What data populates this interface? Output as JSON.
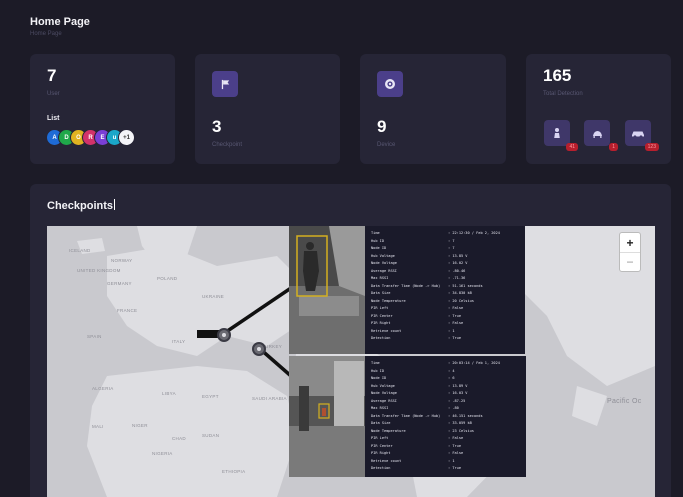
{
  "header": {
    "title": "Home Page",
    "breadcrumb": "Home Page"
  },
  "stats": {
    "users": {
      "value": "7",
      "label": "User",
      "list_label": "List",
      "avatars": [
        {
          "letter": "A",
          "color": "#1e6bd6"
        },
        {
          "letter": "D",
          "color": "#1fa84a"
        },
        {
          "letter": "O",
          "color": "#e0b321"
        },
        {
          "letter": "R",
          "color": "#d2326a"
        },
        {
          "letter": "E",
          "color": "#7a3fd6"
        },
        {
          "letter": "u",
          "color": "#1aa7c9"
        },
        {
          "letter": "+1",
          "color": "#f4f4f8"
        }
      ]
    },
    "checkpoint": {
      "value": "3",
      "label": "Checkpoint",
      "icon": "flag-icon"
    },
    "device": {
      "value": "9",
      "label": "Device",
      "icon": "camera-icon"
    },
    "detection": {
      "value": "165",
      "label": "Total Detection",
      "items": [
        {
          "icon": "person-icon",
          "count": "41"
        },
        {
          "icon": "animal-icon",
          "count": "1"
        },
        {
          "icon": "vehicle-icon",
          "count": "123"
        }
      ]
    }
  },
  "checkpoints": {
    "title": "Checkpoints",
    "map_labels": [
      "ICELAND",
      "NORWAY",
      "UNITED KINGDOM",
      "GERMANY",
      "POLAND",
      "UKRAINE",
      "FRANCE",
      "SPAIN",
      "ITALY",
      "TURKEY",
      "ALGERIA",
      "LIBYA",
      "EGYPT",
      "SAUDI ARABIA",
      "MALI",
      "NIGER",
      "CHAD",
      "SUDAN",
      "NIGERIA",
      "ETHIOPIA",
      "Pacific Oc"
    ],
    "popup1": [
      {
        "k": "Time",
        "v": ": 22:12:30 / Feb 2, 2024"
      },
      {
        "k": "Hub ID",
        "v": ": 7"
      },
      {
        "k": "Node ID",
        "v": ": 7"
      },
      {
        "k": "Hub Voltage",
        "v": ": 13.85 V"
      },
      {
        "k": "Node Voltage",
        "v": ": 16.02 V"
      },
      {
        "k": "Average RSSI",
        "v": ": -80.46"
      },
      {
        "k": "Max RSSI",
        "v": ": -71.36"
      },
      {
        "k": "Data Transfer Time (Node -> Hub)",
        "v": ": 51.161 seconds"
      },
      {
        "k": "Data Size",
        "v": ": 34.830 kB"
      },
      {
        "k": "Node Temperature",
        "v": ": 20 Celsius"
      },
      {
        "k": "PIR Left",
        "v": ": False"
      },
      {
        "k": "PIR Center",
        "v": ": True"
      },
      {
        "k": "PIR Right",
        "v": ": False"
      },
      {
        "k": "Retrieve count",
        "v": ": 1"
      },
      {
        "k": "Detection",
        "v": ": True"
      }
    ],
    "popup2": [
      {
        "k": "Time",
        "v": ": 20:03:14 / Feb 1, 2024"
      },
      {
        "k": "Hub ID",
        "v": ": 4"
      },
      {
        "k": "Node ID",
        "v": ": 6"
      },
      {
        "k": "Hub Voltage",
        "v": ": 13.89 V"
      },
      {
        "k": "Node Voltage",
        "v": ": 16.03 V"
      },
      {
        "k": "Average RSSI",
        "v": ": -87.25"
      },
      {
        "k": "Max RSSI",
        "v": ": -80"
      },
      {
        "k": "Data Transfer Time (Node -> Hub)",
        "v": ": 46.151 seconds"
      },
      {
        "k": "Data Size",
        "v": ": 33.059 kB"
      },
      {
        "k": "Node Temperature",
        "v": ": 23 Celsius"
      },
      {
        "k": "PIR Left",
        "v": ": False"
      },
      {
        "k": "PIR Center",
        "v": ": True"
      },
      {
        "k": "PIR Right",
        "v": ": False"
      },
      {
        "k": "Retrieve count",
        "v": ": 1"
      },
      {
        "k": "Detection",
        "v": ": True"
      }
    ],
    "zoom_in": "+",
    "zoom_out": "−"
  }
}
